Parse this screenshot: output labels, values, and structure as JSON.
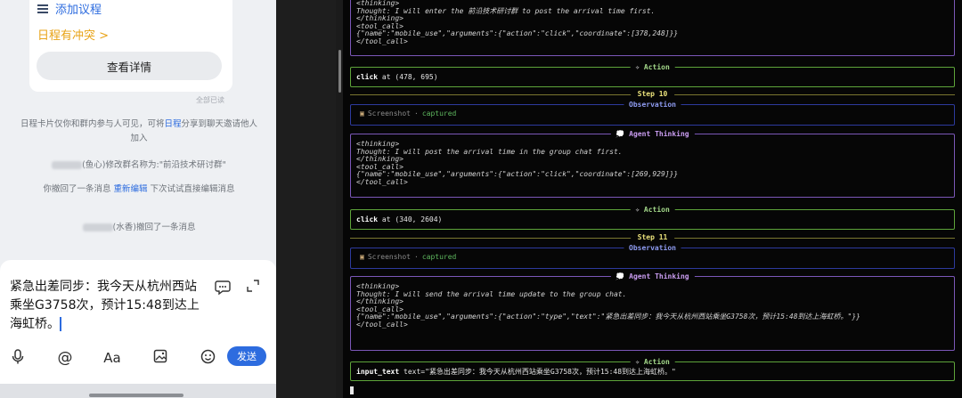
{
  "chat": {
    "add_agenda": "添加议程",
    "conflict": "日程有冲突 >",
    "view_details": "查看详情",
    "all_read": "全部已读",
    "notice_pre": "日程卡片仅你和群内参与人可见，可将",
    "notice_link": "日程",
    "notice_post": "分享到聊天邀请他人加入",
    "rename_mid": "(鱼心)修改群名称为:",
    "rename_name": "\"前沿技术研讨群\"",
    "recall_pre": "你撤回了一条消息",
    "recall_link": "重新编辑",
    "recall_post": "下次试试直接编辑消息",
    "recall2": "(水香)撤回了一条消息",
    "draft": "紧急出差同步：我今天从杭州西站乘坐G3758次，预计15:48到达上海虹桥。",
    "send": "发送"
  },
  "terminal": {
    "top": {
      "l1": "<thinking>",
      "l2": "Thought: I will enter the 前沿技术研讨群 to post the arrival time first.",
      "l3": "</thinking>",
      "l4": "<tool_call>",
      "l5": "{\"name\":\"mobile_use\",\"arguments\":{\"action\":\"click\",\"coordinate\":[378,248]}}",
      "l6": "</tool_call>"
    },
    "action_title": "Action",
    "obs_title": "Observation",
    "think_title": "Agent Thinking",
    "screenshot_label": "Screenshot",
    "screenshot_status": "captured",
    "action1": {
      "cmd": "click",
      "args": "at (478, 695)"
    },
    "step10": "Step 10",
    "think10": {
      "l1": "<thinking>",
      "l2": "Thought: I will post the arrival time in the group chat first.",
      "l3": "</thinking>",
      "l4": "<tool_call>",
      "l5": "{\"name\":\"mobile_use\",\"arguments\":{\"action\":\"click\",\"coordinate\":[269,929]}}",
      "l6": "</tool_call>"
    },
    "action2": {
      "cmd": "click",
      "args": "at (340, 2604)"
    },
    "step11": "Step 11",
    "think11": {
      "l1": "<thinking>",
      "l2": "Thought: I will send the arrival time update to the group chat.",
      "l3": "</thinking>",
      "l4": "<tool_call>",
      "l5": "{\"name\":\"mobile_use\",\"arguments\":{\"action\":\"type\",\"text\":\"紧急出差同步：我今天从杭州西站乘坐G3758次，预计15:48到达上海虹桥。\"}}",
      "l6": "</tool_call>"
    },
    "action3": {
      "cmd": "input_text",
      "args": "text=\"紧急出差同步：我今天从杭州西站乘坐G3758次，预计15:48到达上海虹桥。\""
    }
  }
}
